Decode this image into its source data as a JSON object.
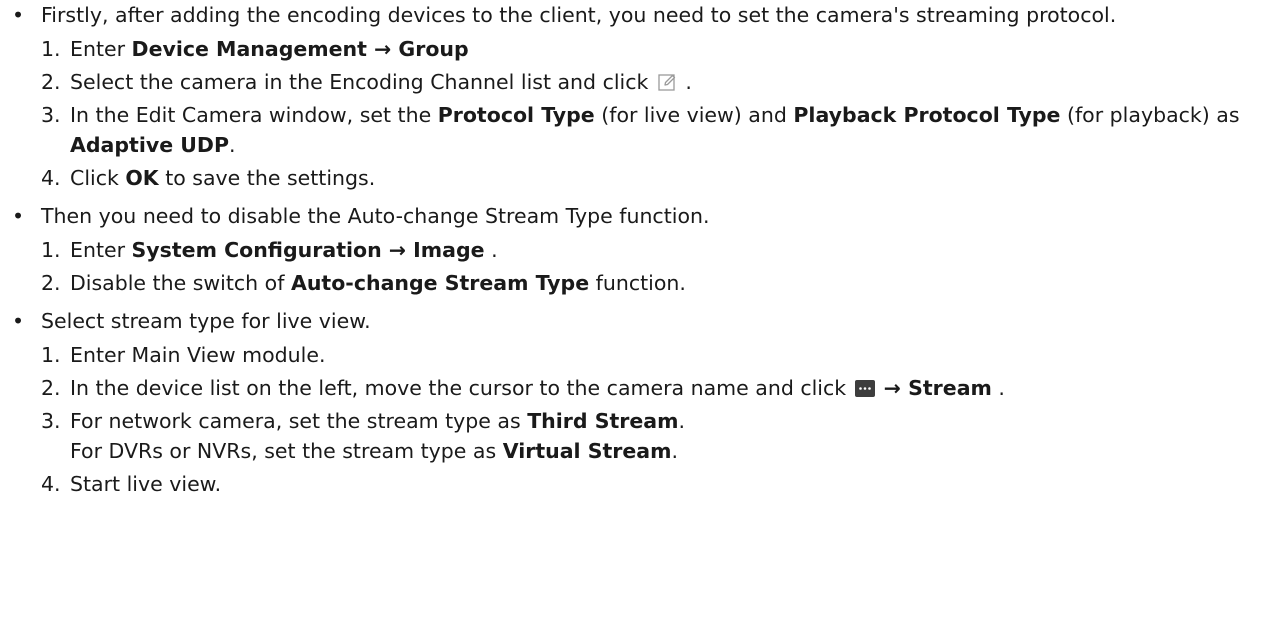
{
  "bullet_symbol": "•",
  "bullets": [
    {
      "text": "Firstly, after adding the encoding devices to the client, you need to set the camera's streaming protocol.",
      "steps": [
        {
          "num": "1.",
          "a": "Enter ",
          "b1": "Device Management → Group"
        },
        {
          "num": "2.",
          "a": "Select the camera in the Encoding Channel list and click ",
          "c": " ."
        },
        {
          "num": "3.",
          "a": "In the Edit Camera window, set the ",
          "b1": "Protocol Type",
          "c": " (for live view) and ",
          "b2": "Playback Protocol Type",
          "d": " (for playback) as ",
          "b3": "Adaptive UDP",
          "e": "."
        },
        {
          "num": "4.",
          "a": "Click ",
          "b1": "OK",
          "c": " to save the settings."
        }
      ]
    },
    {
      "text": "Then you need to disable the Auto-change Stream Type function.",
      "steps": [
        {
          "num": "1.",
          "a": "Enter ",
          "b1": "System Configuration → Image",
          "c": " ."
        },
        {
          "num": "2.",
          "a": "Disable the switch of ",
          "b1": "Auto-change Stream Type",
          "c": " function."
        }
      ]
    },
    {
      "text": "Select stream type for live view.",
      "steps": [
        {
          "num": "1.",
          "a": "Enter Main View module."
        },
        {
          "num": "2.",
          "a": "In the device list on the left, move the cursor to the camera name and click ",
          "b1": " → Stream",
          "c": " ."
        },
        {
          "num": "3.",
          "a": "For network camera, set the stream type as ",
          "b1": "Third Stream",
          "c": ".",
          "line2a": "For DVRs or NVRs, set the stream type as ",
          "line2b": "Virtual Stream",
          "line2c": "."
        },
        {
          "num": "4.",
          "a": "Start live view."
        }
      ]
    }
  ],
  "icons": {
    "edit": "edit-icon",
    "more": "more-icon"
  }
}
